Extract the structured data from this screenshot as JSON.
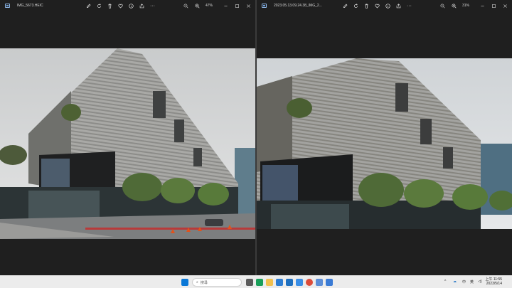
{
  "left_window": {
    "filename": "IMG_5673.HEIC",
    "zoom": "47%"
  },
  "right_window": {
    "filename": "2023.05.13.09.24.38_IMG_2...",
    "zoom": "31%"
  },
  "toolbar_icons": [
    "edit-icon",
    "rotate-icon",
    "delete-icon",
    "favorite-icon",
    "info-icon",
    "share-icon",
    "more-icon"
  ],
  "window_controls": [
    "minimize-icon",
    "maximize-icon",
    "close-icon"
  ],
  "taskbar": {
    "search_placeholder": "搜尋",
    "tray_ime": "中",
    "tray_ime2": "英",
    "clock_time": "上午 11:55",
    "clock_date": "2023/5/14"
  },
  "colors": {
    "window_bg": "#1f1f1f",
    "taskbar_bg": "#ececec",
    "accent": "#0067c0"
  }
}
